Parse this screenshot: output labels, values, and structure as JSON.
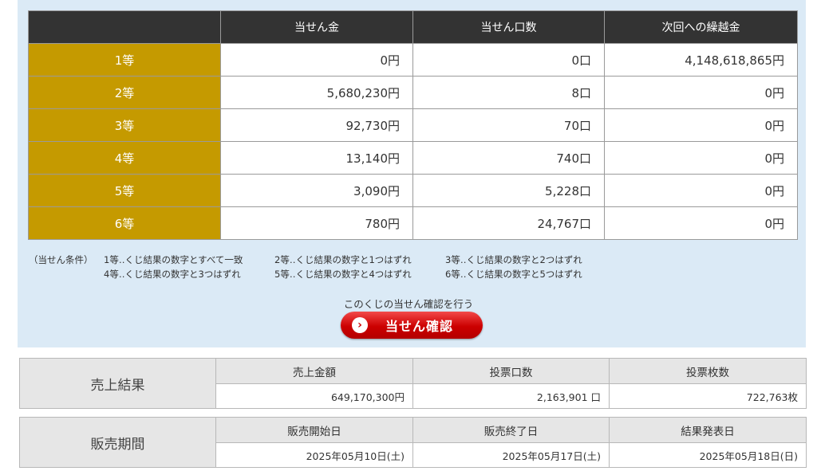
{
  "prize_table": {
    "headers": [
      "当せん金",
      "当せん口数",
      "次回への繰越金"
    ],
    "rows": [
      {
        "rank": "1等",
        "amount": "0円",
        "count": "0口",
        "carryover": "4,148,618,865円"
      },
      {
        "rank": "2等",
        "amount": "5,680,230円",
        "count": "8口",
        "carryover": "0円"
      },
      {
        "rank": "3等",
        "amount": "92,730円",
        "count": "70口",
        "carryover": "0円"
      },
      {
        "rank": "4等",
        "amount": "13,140円",
        "count": "740口",
        "carryover": "0円"
      },
      {
        "rank": "5等",
        "amount": "3,090円",
        "count": "5,228口",
        "carryover": "0円"
      },
      {
        "rank": "6等",
        "amount": "780円",
        "count": "24,767口",
        "carryover": "0円"
      }
    ]
  },
  "conditions": {
    "label": "（当せん条件）",
    "items": [
      "1等‥くじ結果の数字とすべて一致",
      "2等‥くじ結果の数字と1つはずれ",
      "3等‥くじ結果の数字と2つはずれ",
      "4等‥くじ結果の数字と3つはずれ",
      "5等‥くじ結果の数字と4つはずれ",
      "6等‥くじ結果の数字と5つはずれ"
    ]
  },
  "confirm": {
    "text": "このくじの当せん確認を行う",
    "button_label": "当せん確認",
    "button_color": "#cc0000"
  },
  "sales": {
    "title": "売上結果",
    "headers": [
      "売上金額",
      "投票口数",
      "投票枚数"
    ],
    "values": [
      "649,170,300円",
      "2,163,901 口",
      "722,763枚"
    ]
  },
  "period": {
    "title": "販売期間",
    "headers": [
      "販売開始日",
      "販売終了日",
      "結果発表日"
    ],
    "values": [
      "2025年05月10日(土)",
      "2025年05月17日(土)",
      "2025年05月18日(日)"
    ]
  },
  "colors": {
    "panel_bg": "#dbeaf6",
    "rank_bg": "#c59a00",
    "header_bg": "#333333"
  }
}
